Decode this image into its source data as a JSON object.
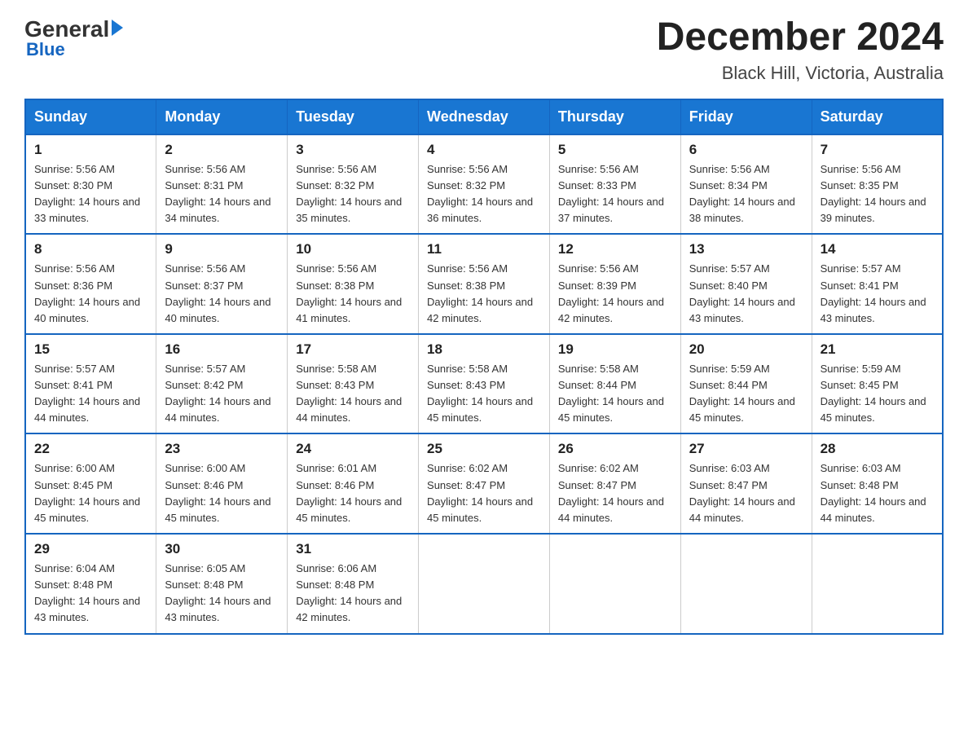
{
  "header": {
    "month_title": "December 2024",
    "location": "Black Hill, Victoria, Australia",
    "logo_general": "General",
    "logo_blue": "Blue"
  },
  "days_of_week": [
    "Sunday",
    "Monday",
    "Tuesday",
    "Wednesday",
    "Thursday",
    "Friday",
    "Saturday"
  ],
  "weeks": [
    [
      {
        "day": "1",
        "sunrise": "5:56 AM",
        "sunset": "8:30 PM",
        "daylight": "14 hours and 33 minutes."
      },
      {
        "day": "2",
        "sunrise": "5:56 AM",
        "sunset": "8:31 PM",
        "daylight": "14 hours and 34 minutes."
      },
      {
        "day": "3",
        "sunrise": "5:56 AM",
        "sunset": "8:32 PM",
        "daylight": "14 hours and 35 minutes."
      },
      {
        "day": "4",
        "sunrise": "5:56 AM",
        "sunset": "8:32 PM",
        "daylight": "14 hours and 36 minutes."
      },
      {
        "day": "5",
        "sunrise": "5:56 AM",
        "sunset": "8:33 PM",
        "daylight": "14 hours and 37 minutes."
      },
      {
        "day": "6",
        "sunrise": "5:56 AM",
        "sunset": "8:34 PM",
        "daylight": "14 hours and 38 minutes."
      },
      {
        "day": "7",
        "sunrise": "5:56 AM",
        "sunset": "8:35 PM",
        "daylight": "14 hours and 39 minutes."
      }
    ],
    [
      {
        "day": "8",
        "sunrise": "5:56 AM",
        "sunset": "8:36 PM",
        "daylight": "14 hours and 40 minutes."
      },
      {
        "day": "9",
        "sunrise": "5:56 AM",
        "sunset": "8:37 PM",
        "daylight": "14 hours and 40 minutes."
      },
      {
        "day": "10",
        "sunrise": "5:56 AM",
        "sunset": "8:38 PM",
        "daylight": "14 hours and 41 minutes."
      },
      {
        "day": "11",
        "sunrise": "5:56 AM",
        "sunset": "8:38 PM",
        "daylight": "14 hours and 42 minutes."
      },
      {
        "day": "12",
        "sunrise": "5:56 AM",
        "sunset": "8:39 PM",
        "daylight": "14 hours and 42 minutes."
      },
      {
        "day": "13",
        "sunrise": "5:57 AM",
        "sunset": "8:40 PM",
        "daylight": "14 hours and 43 minutes."
      },
      {
        "day": "14",
        "sunrise": "5:57 AM",
        "sunset": "8:41 PM",
        "daylight": "14 hours and 43 minutes."
      }
    ],
    [
      {
        "day": "15",
        "sunrise": "5:57 AM",
        "sunset": "8:41 PM",
        "daylight": "14 hours and 44 minutes."
      },
      {
        "day": "16",
        "sunrise": "5:57 AM",
        "sunset": "8:42 PM",
        "daylight": "14 hours and 44 minutes."
      },
      {
        "day": "17",
        "sunrise": "5:58 AM",
        "sunset": "8:43 PM",
        "daylight": "14 hours and 44 minutes."
      },
      {
        "day": "18",
        "sunrise": "5:58 AM",
        "sunset": "8:43 PM",
        "daylight": "14 hours and 45 minutes."
      },
      {
        "day": "19",
        "sunrise": "5:58 AM",
        "sunset": "8:44 PM",
        "daylight": "14 hours and 45 minutes."
      },
      {
        "day": "20",
        "sunrise": "5:59 AM",
        "sunset": "8:44 PM",
        "daylight": "14 hours and 45 minutes."
      },
      {
        "day": "21",
        "sunrise": "5:59 AM",
        "sunset": "8:45 PM",
        "daylight": "14 hours and 45 minutes."
      }
    ],
    [
      {
        "day": "22",
        "sunrise": "6:00 AM",
        "sunset": "8:45 PM",
        "daylight": "14 hours and 45 minutes."
      },
      {
        "day": "23",
        "sunrise": "6:00 AM",
        "sunset": "8:46 PM",
        "daylight": "14 hours and 45 minutes."
      },
      {
        "day": "24",
        "sunrise": "6:01 AM",
        "sunset": "8:46 PM",
        "daylight": "14 hours and 45 minutes."
      },
      {
        "day": "25",
        "sunrise": "6:02 AM",
        "sunset": "8:47 PM",
        "daylight": "14 hours and 45 minutes."
      },
      {
        "day": "26",
        "sunrise": "6:02 AM",
        "sunset": "8:47 PM",
        "daylight": "14 hours and 44 minutes."
      },
      {
        "day": "27",
        "sunrise": "6:03 AM",
        "sunset": "8:47 PM",
        "daylight": "14 hours and 44 minutes."
      },
      {
        "day": "28",
        "sunrise": "6:03 AM",
        "sunset": "8:48 PM",
        "daylight": "14 hours and 44 minutes."
      }
    ],
    [
      {
        "day": "29",
        "sunrise": "6:04 AM",
        "sunset": "8:48 PM",
        "daylight": "14 hours and 43 minutes."
      },
      {
        "day": "30",
        "sunrise": "6:05 AM",
        "sunset": "8:48 PM",
        "daylight": "14 hours and 43 minutes."
      },
      {
        "day": "31",
        "sunrise": "6:06 AM",
        "sunset": "8:48 PM",
        "daylight": "14 hours and 42 minutes."
      },
      null,
      null,
      null,
      null
    ]
  ]
}
